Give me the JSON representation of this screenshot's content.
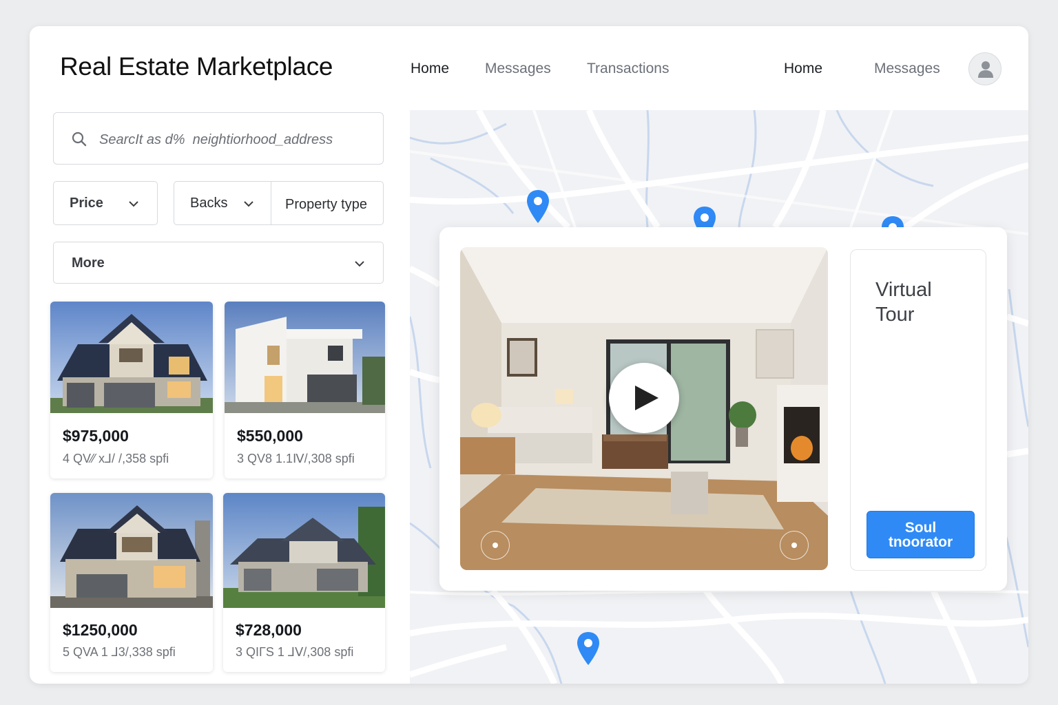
{
  "header": {
    "title": "Real Estate Marketplace",
    "nav_primary": [
      "Home",
      "Messages",
      "Transactions"
    ],
    "nav_secondary": [
      "Home",
      "Messages"
    ],
    "avatar_icon": "user-icon"
  },
  "search": {
    "placeholder": "SearcIt as d%  neightiorhood_address",
    "icon": "search-icon"
  },
  "filters": {
    "price": "Price",
    "backs": "Backs",
    "property_type": "Property type",
    "more": "More"
  },
  "listings": [
    {
      "price": "$975,000",
      "details": "4 QV⁄⁄ x⅃/ /,358 spfi"
    },
    {
      "price": "$550,000",
      "details": "3 QV8 1.1Ⅳ/,308 spfi"
    },
    {
      "price": "$1250,000",
      "details": "5 QVA  1 ⅃3/,338 spfi"
    },
    {
      "price": "$728,000",
      "details": "3 QΙΓS 1 ⅃Ⅴ/,308 spfi"
    }
  ],
  "map": {
    "pin_color": "#2f8af5",
    "tour": {
      "title": "Virtual Tour",
      "cta": "Soul tnoorator",
      "play_icon": "play-icon"
    }
  },
  "colors": {
    "accent": "#2f8af5",
    "road": "#ffffff",
    "water": "#c7d7ee"
  }
}
